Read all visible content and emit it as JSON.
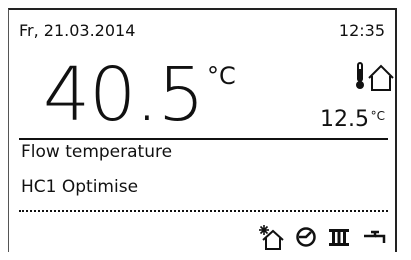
{
  "header": {
    "date": "Fr, 21.03.2014",
    "time": "12:35"
  },
  "main": {
    "temperature": "40.5",
    "unit": "°C",
    "label": "Flow temperature"
  },
  "outdoor": {
    "icon": "outdoor-temperature-icon",
    "temperature": "12.5",
    "unit": "°C"
  },
  "heating_circuit": {
    "name": "HC1 Optimise"
  },
  "status_icons": [
    "frost-protection-house-icon",
    "clock-icon",
    "heating-icon",
    "hot-water-icon"
  ]
}
